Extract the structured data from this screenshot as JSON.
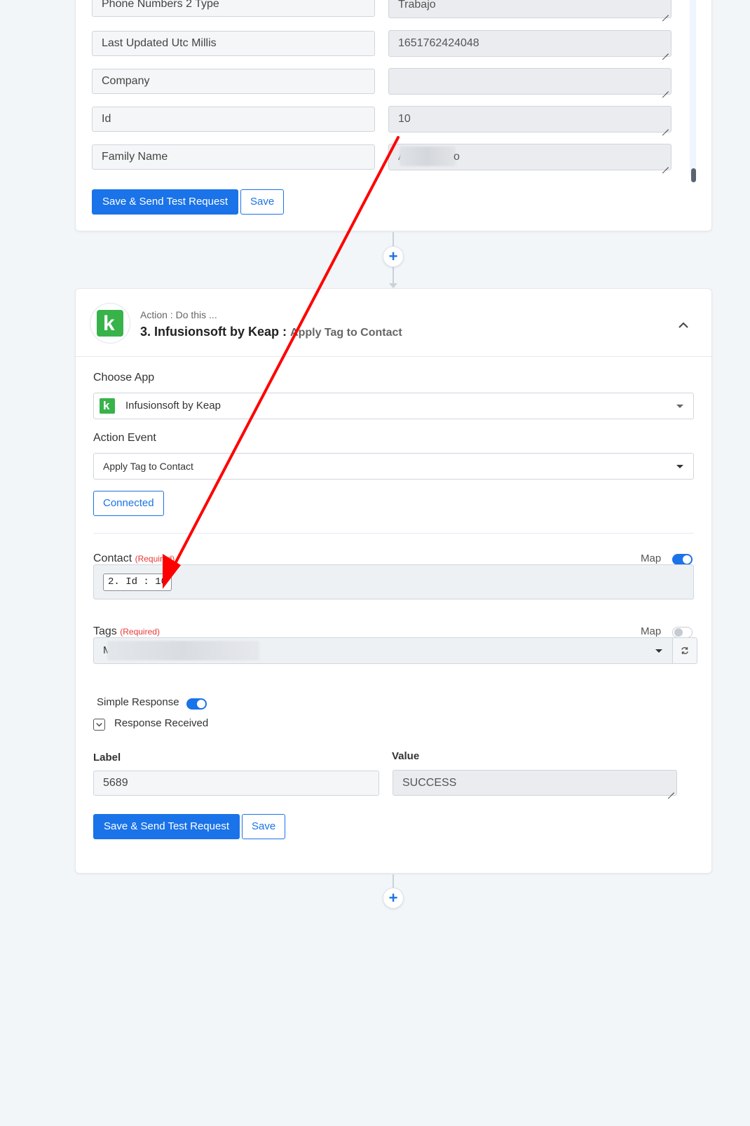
{
  "top_card": {
    "rows": [
      {
        "label": "Phone Numbers 2 Type",
        "value": "Trabajo"
      },
      {
        "label": "Last Updated Utc Millis",
        "value": "1651762424048"
      },
      {
        "label": "Company",
        "value": ""
      },
      {
        "label": "Id",
        "value": "10"
      },
      {
        "label": "Family Name",
        "value_first_char": "A",
        "value_last_char": "o"
      }
    ],
    "save_send_label": "Save & Send Test Request",
    "save_label": "Save"
  },
  "action_card": {
    "subtitle": "Action : Do this ...",
    "title": "3. Infusionsoft by Keap : ",
    "event_title": "Apply Tag to Contact",
    "logo_letter": "k",
    "choose_app_label": "Choose App",
    "choose_app_value": "Infusionsoft by Keap",
    "action_event_label": "Action Event",
    "action_event_value": "Apply Tag to Contact",
    "connected_label": "Connected",
    "contact_label": "Contact",
    "contact_required": "(Required)",
    "contact_map_label": "Map",
    "contact_token": "2. Id : 10",
    "tags_label": "Tags",
    "tags_required": "(Required)",
    "tags_map_label": "Map",
    "tags_value_first_char": "M",
    "simple_response_label": "Simple Response",
    "response_received_label": "Response Received",
    "response_label_header": "Label",
    "response_value_header": "Value",
    "response_label_value": "5689",
    "response_value_value": "SUCCESS",
    "save_send_label": "Save & Send Test Request",
    "save_label": "Save"
  },
  "colors": {
    "accent": "#1a73e8",
    "annotation_arrow": "#ff0000",
    "keap_green": "#37b34a",
    "required": "#e53935"
  },
  "toggles": {
    "contact_map": true,
    "tags_map": false,
    "simple_response": true
  },
  "icons": [
    "plus-icon",
    "chevron-up-icon",
    "caret-down-icon",
    "refresh-icon",
    "chevron-down-icon",
    "keap-logo-icon",
    "resize-grip-icon"
  ]
}
